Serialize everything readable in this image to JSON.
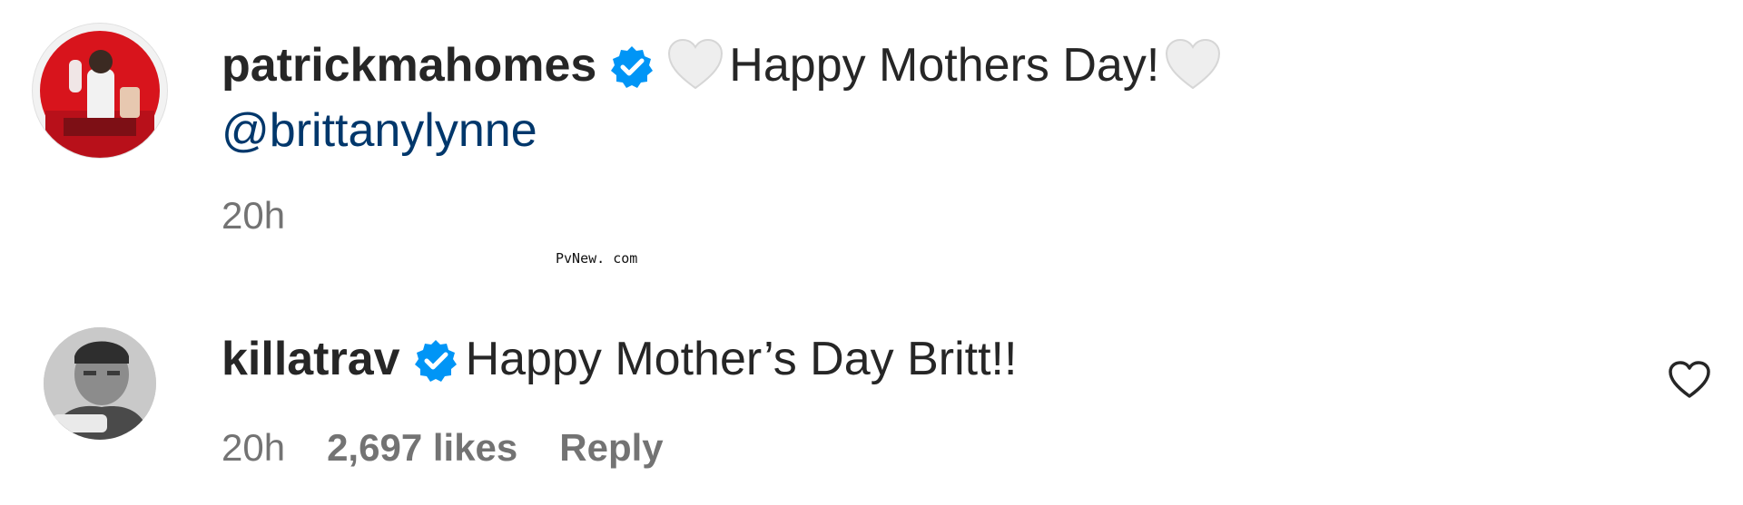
{
  "comments": [
    {
      "username": "patrickmahomes",
      "verified": true,
      "text_before": "Happy Mothers Day!",
      "mention": "@brittanylynne",
      "time": "20h"
    },
    {
      "username": "killatrav",
      "verified": true,
      "text": "Happy Mother’s Day Britt!!",
      "time": "20h",
      "likes": "2,697 likes",
      "reply_label": "Reply"
    }
  ],
  "watermark": "PvNew. com",
  "icons": {
    "verified": "verified-badge-icon",
    "heart_emoji": "white-heart-emoji",
    "like": "heart-outline-icon"
  },
  "colors": {
    "verified_blue": "#0095f6",
    "mention_blue": "#00376b",
    "secondary_text": "#737373",
    "primary_text": "#262626"
  }
}
